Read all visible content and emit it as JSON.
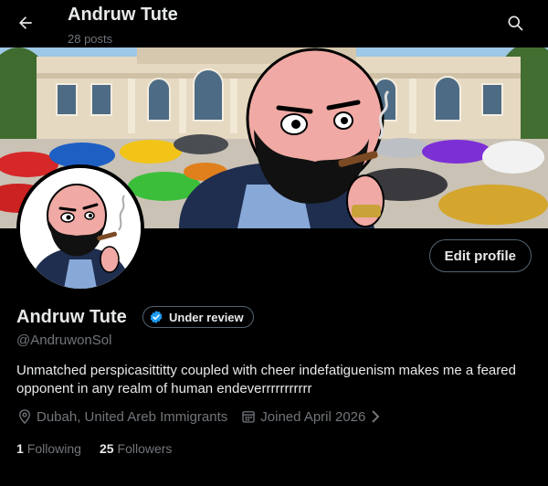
{
  "header": {
    "title": "Andruw Tute",
    "posts": "28 posts"
  },
  "profile": {
    "display_name": "Andruw Tute",
    "badge_label": "Under review",
    "handle": "@AndruwonSol",
    "bio": "Unmatched perspicasittitty  coupled with cheer indefatiguenism makes me a feared opponent in any realm of human endeverrrrrrrrrrr",
    "location": "Dubah, United Areb Immigrants",
    "joined": "Joined April 2026",
    "following_count": "1",
    "following_label": "Following",
    "followers_count": "25",
    "followers_label": "Followers"
  },
  "actions": {
    "edit_profile": "Edit profile"
  },
  "colors": {
    "background": "#000000",
    "text_primary": "#e7e9ea",
    "text_secondary": "#71767b",
    "verified_blue": "#1d9bf0",
    "border": "#536471"
  },
  "icons": [
    "back-arrow-icon",
    "search-icon",
    "verified-badge-icon",
    "location-pin-icon",
    "calendar-icon",
    "chevron-right-icon"
  ]
}
